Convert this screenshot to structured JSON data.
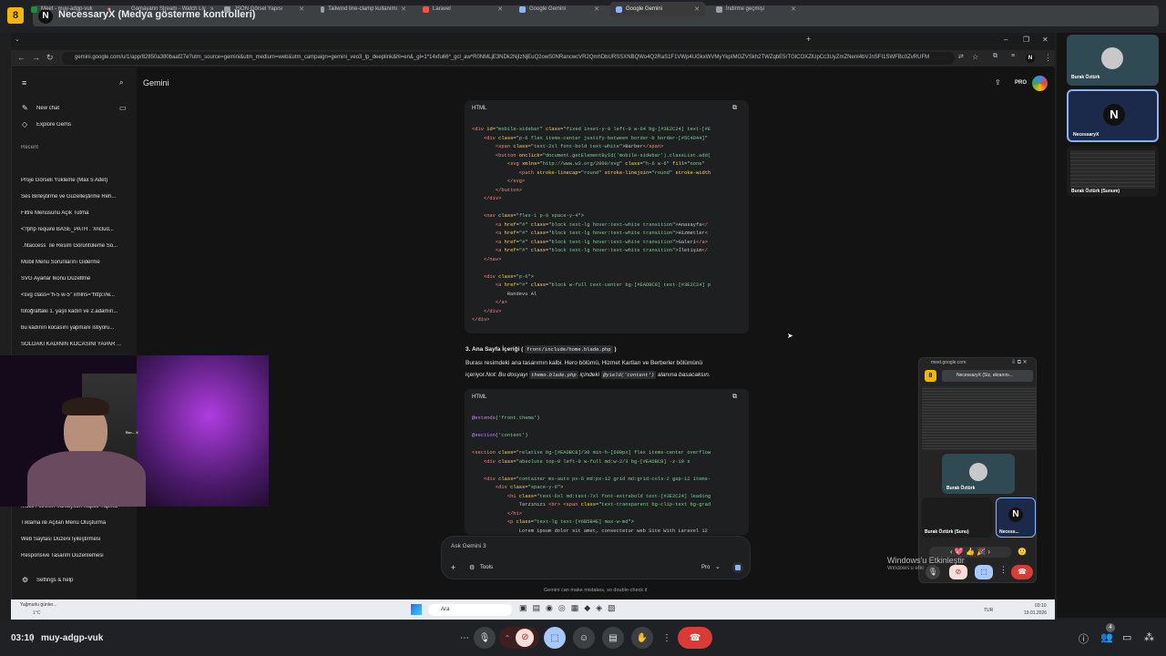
{
  "meet_top": {
    "badge": "8",
    "title": "NecessaryX (Medya gösterme kontrolleri)"
  },
  "tabs": [
    {
      "label": "Meet - muy-adgp-vuk",
      "color": "#1e8e3e"
    },
    {
      "label": "Gamayann Stream - Watch Liv",
      "color": "#9146ff"
    },
    {
      "label": "JSON Görsel Yapısı",
      "color": "#9aa0a6"
    },
    {
      "label": "Tailwind line-clamp kullanımı",
      "color": "#9aa0a6"
    },
    {
      "label": "Laravel",
      "color": "#f55247"
    },
    {
      "label": "Google Gemini",
      "color": "#8ab4f8"
    },
    {
      "label": "Google Gemini",
      "color": "#8ab4f8"
    },
    {
      "label": "İndirme geçmişi",
      "color": "#9aa0a6"
    }
  ],
  "url": "gemini.google.com/u/1/app/82850a380baaf27e?utm_source=gemini&utm_medium=web&utm_campaign=gemini_veo3_lp_deeplink&hl=en&_gl=1*14xfu66*_gcl_aw*R0NMLjE3NDk2NjIzNjEuQ2owS0NRancwcVR2QmhDbURSSXNBQWo4Q2RaS1F1VWp4UGkxWVMyYkpIMGZVSkh2TWZqbE5rTGlCOXZlUpCc3UyZmZNenI4bVJnSFI1SWFBc0ZvRUFM",
  "sidebar": {
    "new_chat": "New chat",
    "explore_gems": "Explore Gems",
    "recent_label": "Recent",
    "recent": [
      "Proje Görseli Yükleme (Max 5 Adet)",
      "Ses Birleştirme ve Güzelleştirme Reh...",
      "Filtre Menüsünü Açık Tutma",
      "<?php    require BASE_PATH . '/includ...",
      "`.htaccess` ile Resim Görüntüleme So...",
      "Mobil Menü Sorunlarını Giderme",
      "SVG Ayarlar İkonu Düzeltme",
      "<svg class=\"h-5 w-5\" xmlns=\"http://w...",
      "fotoğraftaki 1. yaşlı kadın ve 2.adamın...",
      "bu kadının kocasını yapmanı istiyoru...",
      "SOLDAKİ KADININ KOCASINI YAPAR ..."
    ],
    "recent_bottom": [
      "Mobil Filtreleri Varsayılan Kapalı Yapma",
      "Tıklama ile Açılan Menü Oluşturma",
      "Web Sayfası Düzeni İyileştirmesi",
      "Responsive Tasarım Düzenlemesi"
    ],
    "settings": "Settings & help"
  },
  "app": {
    "title": "Gemini",
    "pro": "PRO"
  },
  "code1": {
    "label": "HTML"
  },
  "section": {
    "heading": "3. Ana Sayfa İçeriği (",
    "path": "front/include/home.blade.php",
    "heading_end": ")",
    "p1": "Burası resimdeki ana tasarımın kalbi. Hero bölümü, Hizmet Kartları ve Berberler bölümünü",
    "p2a": "içeriyor.",
    "p2b": "Not: Bu dosyayı",
    "p2c": "themo.blade.php",
    "p2d": "içindeki",
    "p2e": "@yield('content')",
    "p2f": "alanına basacaksın."
  },
  "code2": {
    "label": "HTML"
  },
  "input": {
    "placeholder": "Ask Gemini 3",
    "tools": "Tools",
    "model": "Pro"
  },
  "disclaimer": "Gemini can make mistakes, so double-check it",
  "webcam": {
    "name": "Bur... X"
  },
  "participants": [
    {
      "name": "Burak Öztürk"
    },
    {
      "name": "NecessaryX"
    },
    {
      "name": "Burak Öztürk (Sunum)"
    }
  ],
  "mini": {
    "host": "meet.google.com",
    "tab": "NecessaryX (Siz, ekranını...",
    "participant": "Burak Öztürk",
    "tile1": "Burak Öztürk (Sunu)",
    "tile2": "Necess..."
  },
  "watermark": {
    "line1": "Windows'u Etkinleştir",
    "line2": "Windows'u etkinleştirmek için Ayarlar'a gidin."
  },
  "taskbar": {
    "weather": "Yağmurlu günler...",
    "temp": "1°C",
    "search": "Ara",
    "lang": "TUR",
    "time": "03:10",
    "date": "19.01.2026"
  },
  "meet_bottom": {
    "time": "03:10",
    "code": "muy-adgp-vuk",
    "badge": "4"
  }
}
